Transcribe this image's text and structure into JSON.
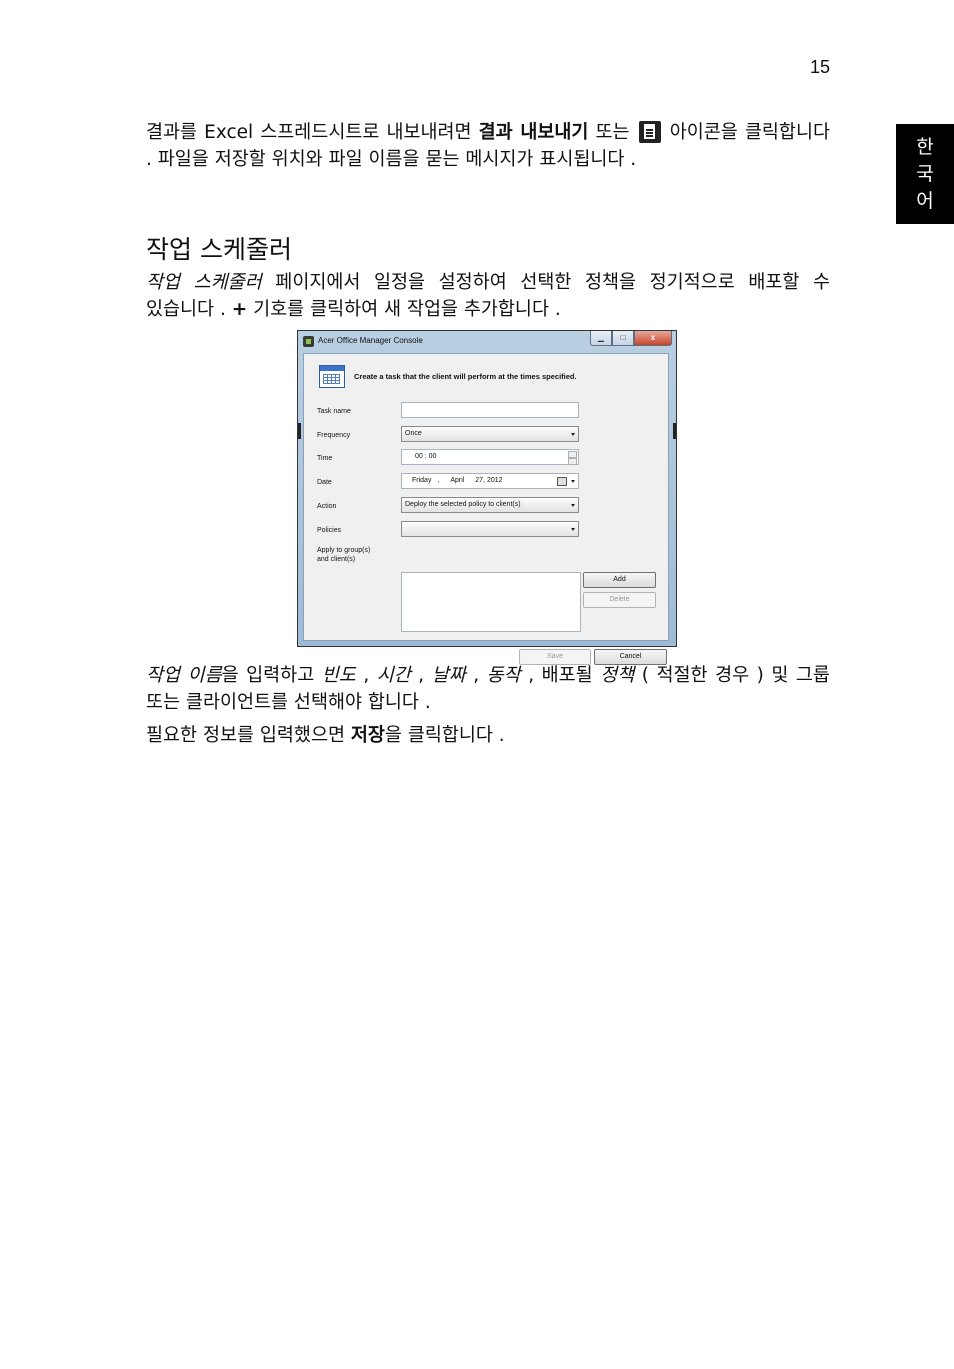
{
  "page_number": "15",
  "side_tab": [
    "한",
    "국",
    "어"
  ],
  "para1": {
    "t1": "결과를 Excel 스프레드시트로 내보내려면 ",
    "bold1": "결과 내보내기",
    "t2": " 또는 ",
    "icon": "document-icon",
    "t3": " 아이콘을 클릭합니다 . 파일을 저장할 위치와 파일 이름을 묻는 메시지가 표시됩니다 ."
  },
  "heading": "작업 스케줄러",
  "para2": {
    "italic1": "작업 스케줄러",
    "t1": " 페이지에서 일정을 설정하여 선택한 정책을 정기적으로 배포할 수 있습니다 . ",
    "bold1": "+",
    "t2": " 기호를 클릭하여 새 작업을 추가합니다 ."
  },
  "screenshot": {
    "title": "Acer Office Manager Console",
    "controls": {
      "minimize": "▁",
      "maximize": "□",
      "close": "x"
    },
    "header": "Create a task that the client will perform at the times specified.",
    "labels": {
      "task_name": "Task name",
      "frequency": "Frequency",
      "time": "Time",
      "date": "Date",
      "action": "Action",
      "policies": "Policies",
      "apply_line1": "Apply to group(s)",
      "apply_line2": "and client(s)"
    },
    "values": {
      "task_name": "",
      "frequency": "Once",
      "time": "00 : 00",
      "date_day": "Friday",
      "date_sep": ",",
      "date_month": "April",
      "date_rest": "27, 2012",
      "action": "Deploy the selected policy to client(s)",
      "policies": ""
    },
    "buttons": {
      "add": "Add",
      "delete": "Delete",
      "save": "Save",
      "cancel": "Cancel"
    }
  },
  "para3": {
    "i1": "작업 이름",
    "t1": "을 입력하고 ",
    "i2": "빈도",
    "t2": " , ",
    "i3": "시간",
    "t3": " , ",
    "i4": "날짜",
    "t4": " , ",
    "i5": "동작",
    "t5": " , 배포될 ",
    "i6": "정책",
    "t6": " ( 적절한 경우 ) 및 그룹 또는 클라이언트를 선택해야 합니다 ."
  },
  "para4": {
    "t1": "필요한 정보를 입력했으면 ",
    "bold1": "저장",
    "t2": "을 클릭합니다 ."
  }
}
